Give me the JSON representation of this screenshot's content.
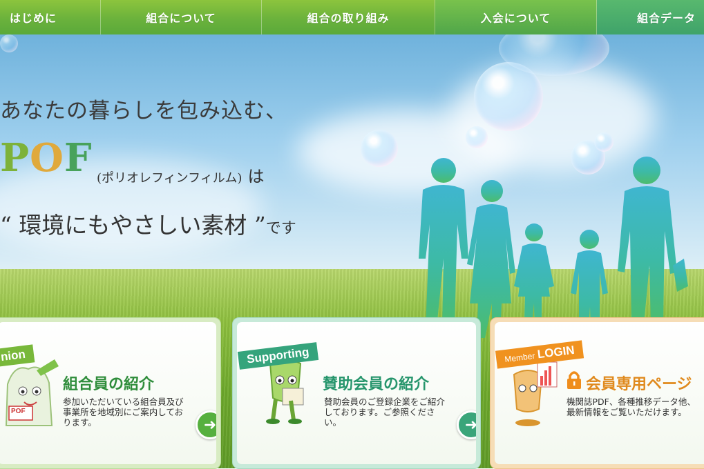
{
  "nav": {
    "items": [
      {
        "label": "はじめに"
      },
      {
        "label": "組合について"
      },
      {
        "label": "組合の取り組み"
      },
      {
        "label": "入会について"
      },
      {
        "label": "組合データ"
      }
    ]
  },
  "hero": {
    "line1": "あなたの暮らしを包み込む、",
    "pof_p": "P",
    "pof_o": "O",
    "pof_f": "F",
    "pof_sub": "(ポリオレフィンフィルム)",
    "pof_wa": "は",
    "line3_main": "“ 環境にもやさしい素材 ”",
    "line3_tail": "です"
  },
  "cards": [
    {
      "ribbon": "nion",
      "title": "組合員の紹介",
      "desc": "参加いただいている組合員及び事業所を地域別にご案内しております。",
      "bag_label": "POF"
    },
    {
      "ribbon": "Supporting",
      "title": "賛助会員の紹介",
      "desc": "賛助会員のご登録企業をご紹介しております。ご参照ください。"
    },
    {
      "ribbon_small": "Member",
      "ribbon": "LOGIN",
      "title": "会員専用ページ",
      "desc": "機関誌PDF、各種推移データ他、最新情報をご覧いただけます。"
    }
  ],
  "colors": {
    "nav_green": "#6bb23c",
    "card1_title": "#2f8d3b",
    "card2_title": "#26956c",
    "card3_title": "#e08a1e",
    "card1_arrow": "#56b03f",
    "card2_arrow": "#3aa57a",
    "card3_arrow": "#f39a2a"
  }
}
